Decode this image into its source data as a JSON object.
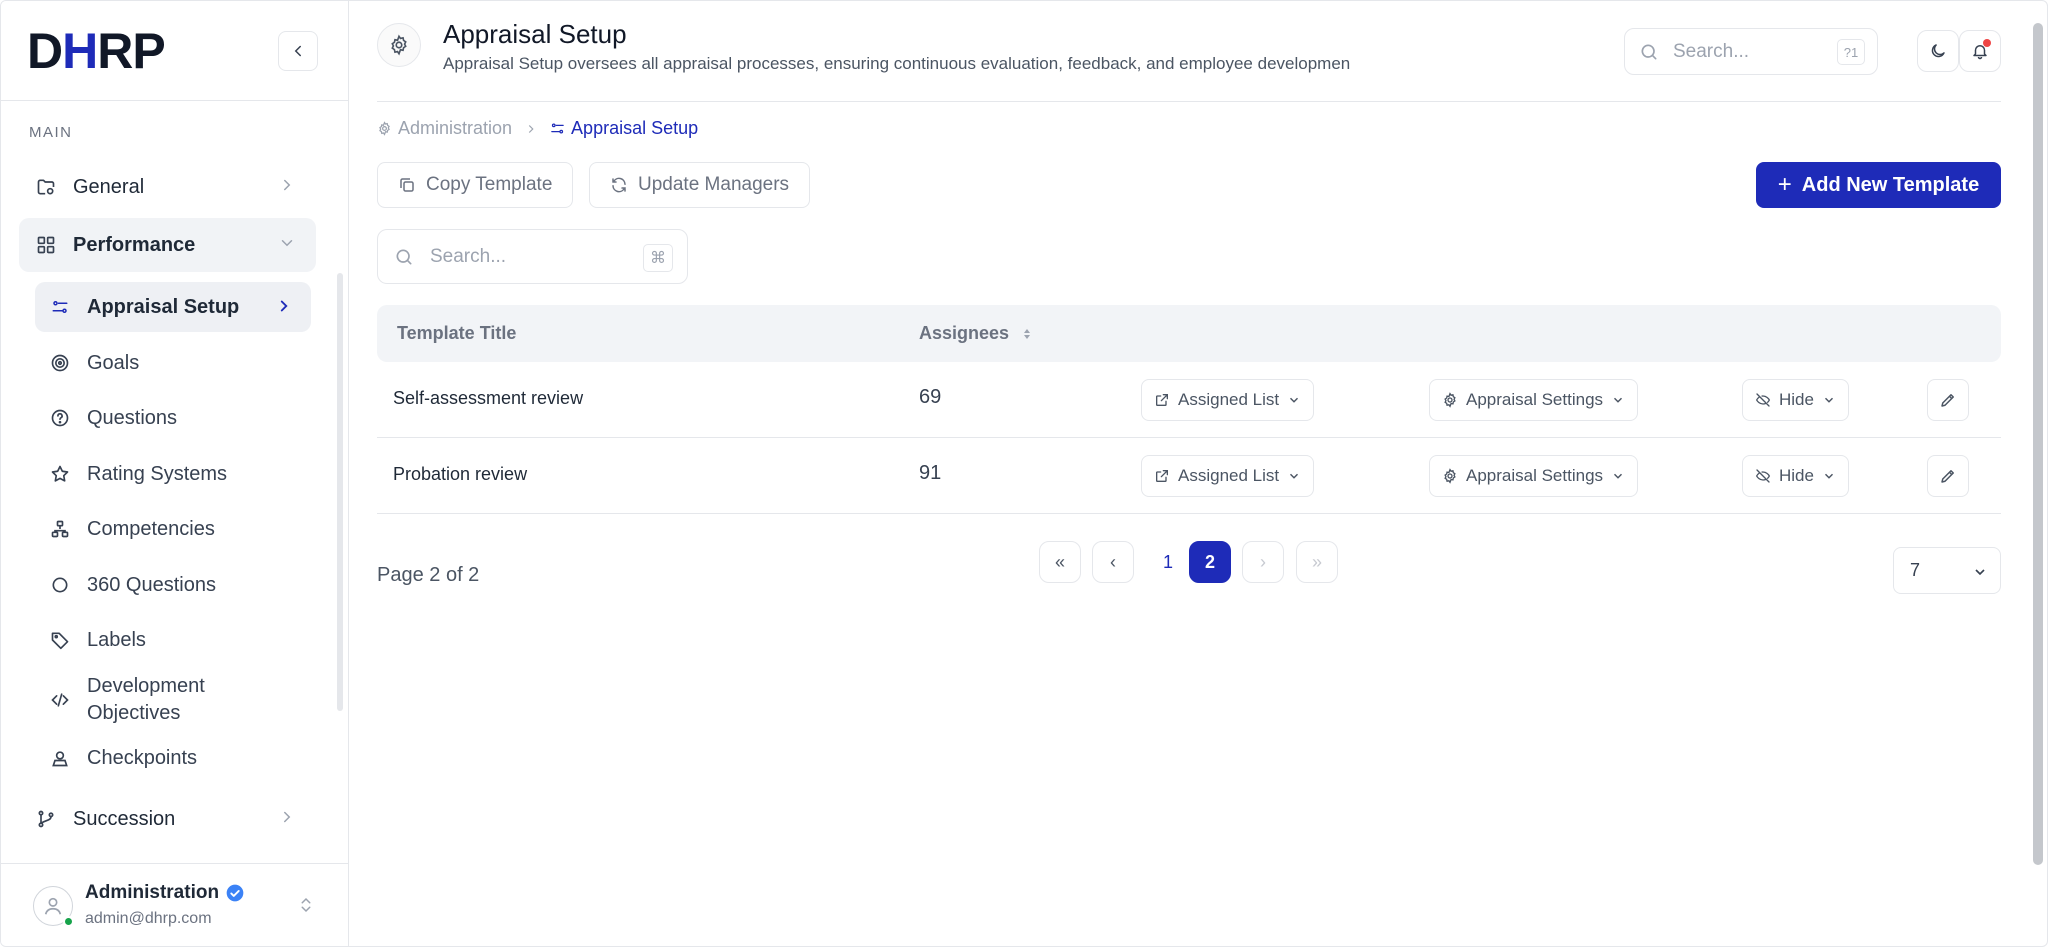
{
  "brand": {
    "logo_d": "D",
    "logo_h": "H",
    "logo_rp": "RP"
  },
  "sidebar": {
    "section_label": "MAIN",
    "top_items": [
      {
        "label": "General",
        "icon": "folder-settings-icon"
      },
      {
        "label": "Performance",
        "icon": "grid-icon"
      },
      {
        "label": "Succession",
        "icon": "git-branch-icon"
      }
    ],
    "sub_items": [
      {
        "label": "Appraisal Setup",
        "icon": "sliders-icon"
      },
      {
        "label": "Goals",
        "icon": "target-icon"
      },
      {
        "label": "Questions",
        "icon": "help-circle-icon"
      },
      {
        "label": "Rating Systems",
        "icon": "star-icon"
      },
      {
        "label": "Competencies",
        "icon": "network-icon"
      },
      {
        "label": "360 Questions",
        "icon": "circle-icon"
      },
      {
        "label": "Labels",
        "icon": "tag-icon"
      },
      {
        "label": "Development",
        "label2": "Objectives",
        "icon": "code-icon"
      },
      {
        "label": "Checkpoints",
        "icon": "user-pin-icon"
      }
    ]
  },
  "user": {
    "name": "Administration",
    "email": "admin@dhrp.com"
  },
  "header": {
    "title": "Appraisal Setup",
    "subtitle": "Appraisal Setup oversees all appraisal processes, ensuring continuous evaluation, feedback, and employee developmen",
    "search_placeholder": "Search...",
    "search_shortcut": "?1"
  },
  "breadcrumb": {
    "parent": "Administration",
    "current": "Appraisal Setup"
  },
  "actions": {
    "copy_template": "Copy Template",
    "update_managers": "Update Managers",
    "add_template": "Add New Template"
  },
  "table": {
    "search_placeholder": "Search...",
    "search_shortcut": "⌘",
    "columns": [
      "Template Title",
      "Assignees"
    ],
    "rows": [
      {
        "title": "Self-assessment review",
        "assignees": "69",
        "assigned_list": "Assigned List",
        "appraisal_settings": "Appraisal Settings",
        "visibility": "Hide"
      },
      {
        "title": "Probation review",
        "assignees": "91",
        "assigned_list": "Assigned List",
        "appraisal_settings": "Appraisal Settings",
        "visibility": "Hide"
      }
    ]
  },
  "pagination": {
    "info": "Page 2 of 2",
    "first": "«",
    "prev": "‹",
    "next": "›",
    "last": "»",
    "pages": [
      "1",
      "2"
    ],
    "current_page": 2,
    "page_size": "7"
  },
  "colors": {
    "accent": "#1e2bb8",
    "notification": "#ef4444",
    "online": "#16a34a",
    "verified": "#3b82f6"
  }
}
